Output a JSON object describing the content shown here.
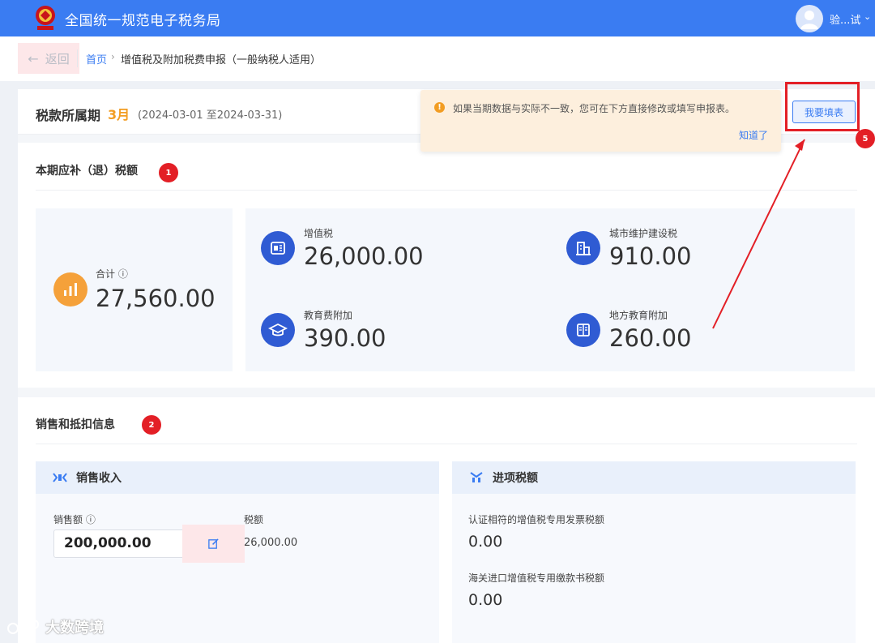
{
  "header": {
    "title": "全国统一规范电子税务局",
    "user_name": "验...试",
    "caret": "⌄"
  },
  "breadcrumb": {
    "back_label": "返回",
    "home": "首页",
    "separator": "›",
    "current": "增值税及附加税费申报（一般纳税人适用）"
  },
  "period": {
    "label": "税款所属期",
    "month": "3月",
    "range": "(2024-03-01 至2024-03-31)"
  },
  "alert": {
    "icon": "!",
    "text": "如果当期数据与实际不一致，您可在下方直接修改或填写申报表。",
    "dismiss": "知道了"
  },
  "fill_button": "我要填表",
  "section1": {
    "title": "本期应补（退）税额",
    "badge": "1",
    "total_label": "合计 ⓘ",
    "total_value": "27,560.00",
    "items": [
      {
        "label": "增值税",
        "value": "26,000.00",
        "icon": "tax-doc-icon"
      },
      {
        "label": "城市维护建设税",
        "value": "910.00",
        "icon": "building-icon"
      },
      {
        "label": "教育费附加",
        "value": "390.00",
        "icon": "graduation-cap-icon"
      },
      {
        "label": "地方教育附加",
        "value": "260.00",
        "icon": "book-icon"
      }
    ]
  },
  "section2": {
    "title": "销售和抵扣信息",
    "badge": "2",
    "sales": {
      "title": "销售收入",
      "amount_label": "销售额 ⓘ",
      "amount_value": "200,000.00",
      "tax_label": "税额",
      "tax_value": "26,000.00"
    },
    "input_tax": {
      "title": "进项税额",
      "row1_label": "认证相符的增值税专用发票税额",
      "row1_value": "0.00",
      "row2_label": "海关进口增值税专用缴款书税额",
      "row2_value": "0.00"
    }
  },
  "annotation": {
    "badge5": "5"
  },
  "watermark": "大数跨境",
  "colors": {
    "brand_blue": "#3a7cf2",
    "accent_orange": "#f29d23",
    "annotation_red": "#e31f26",
    "icon_blue": "#2f5bd3"
  }
}
